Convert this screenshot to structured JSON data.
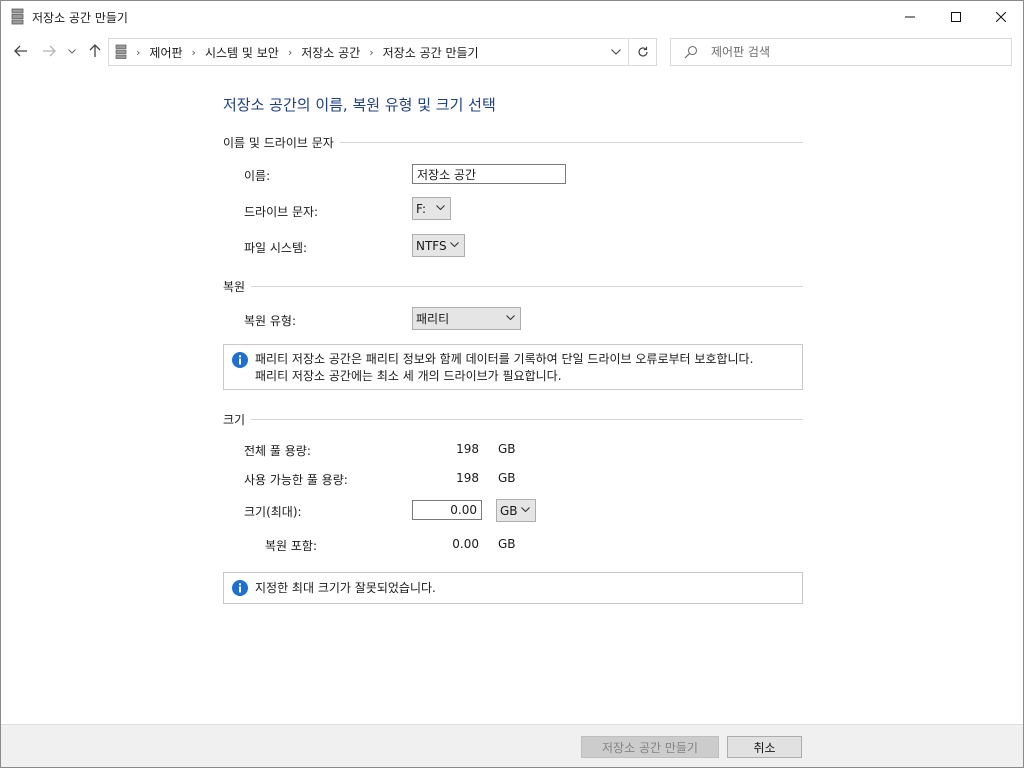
{
  "window": {
    "title": "저장소 공간 만들기"
  },
  "nav": {
    "breadcrumbs": [
      "제어판",
      "시스템 및 보안",
      "저장소 공간",
      "저장소 공간 만들기"
    ],
    "search_placeholder": "제어판 검색"
  },
  "page": {
    "title": "저장소 공간의 이름, 복원 유형 및 크기 선택"
  },
  "name_section": {
    "header": "이름 및 드라이브 문자",
    "name_label": "이름:",
    "name_value": "저장소 공간",
    "drive_label": "드라이브 문자:",
    "drive_value": "F:",
    "fs_label": "파일 시스템:",
    "fs_value": "NTFS"
  },
  "resiliency_section": {
    "header": "복원",
    "type_label": "복원 유형:",
    "type_value": "패리티",
    "info_line1": "패리티 저장소 공간은 패리티 정보와 함께 데이터를 기록하여 단일 드라이브 오류로부터 보호합니다.",
    "info_line2": "패리티 저장소 공간에는 최소 세 개의 드라이브가 필요합니다."
  },
  "size_section": {
    "header": "크기",
    "total_label": "전체 풀 용량:",
    "total_value": "198",
    "total_unit": "GB",
    "available_label": "사용 가능한 풀 용량:",
    "available_value": "198",
    "available_unit": "GB",
    "size_label": "크기(최대):",
    "size_value": "0.00",
    "size_unit": "GB",
    "incl_label": "복원 포함:",
    "incl_value": "0.00",
    "incl_unit": "GB",
    "error_text": "지정한 최대 크기가 잘못되었습니다."
  },
  "footer": {
    "create_label": "저장소 공간 만들기",
    "cancel_label": "취소"
  },
  "colors": {
    "title_blue": "#1e3f8a",
    "info_icon_blue": "#1f6fd0"
  }
}
